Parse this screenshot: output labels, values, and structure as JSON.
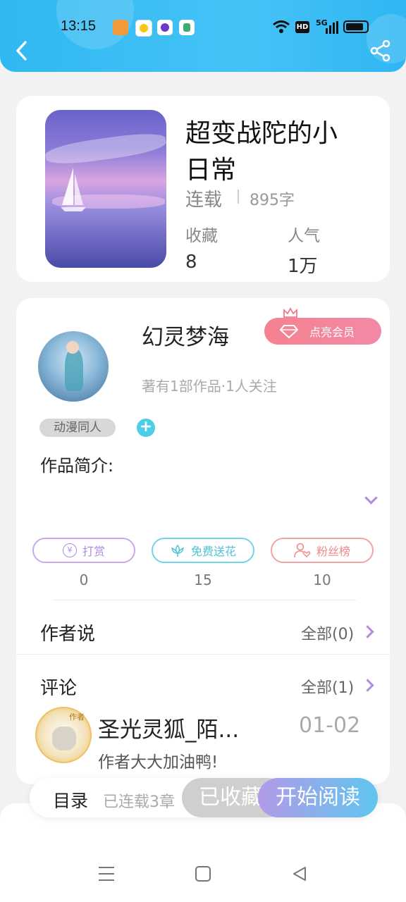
{
  "status_bar": {
    "time": "13:15",
    "hd": "HD",
    "network": "5G"
  },
  "header": {},
  "book": {
    "title_line1": "超变战陀的小",
    "title_line2": "日常",
    "status": "连载",
    "word_count": "895字",
    "collect_label": "收藏",
    "collect_value": "8",
    "popularity_label": "人气",
    "popularity_value": "1万"
  },
  "author": {
    "name": "幻灵梦海",
    "vip_button": "点亮会员",
    "stats": "著有1部作品·1人关注",
    "tag": "动漫同人",
    "intro_label": "作品简介:"
  },
  "actions": [
    {
      "label": "打赏",
      "count": "0"
    },
    {
      "label": "免费送花",
      "count": "15"
    },
    {
      "label": "粉丝榜",
      "count": "10"
    }
  ],
  "author_says": {
    "title": "作者说",
    "all": "全部(0)"
  },
  "comments": {
    "title": "评论",
    "all": "全部(1)",
    "items": [
      {
        "user": "圣光灵狐_陌...",
        "date": "01-02",
        "text": "作者大大加油鸭!",
        "avatar_badge": "作者"
      }
    ]
  },
  "bottom_bar": {
    "catalog": "目录",
    "progress": "已连载3章",
    "collected": "已收藏",
    "start_read": "开始阅读"
  },
  "colors": {
    "header": "#2fb8f2",
    "purple": "#b08be0",
    "teal": "#4fd0e0",
    "salmon": "#f08a8a",
    "vip": "#f07a8a"
  }
}
